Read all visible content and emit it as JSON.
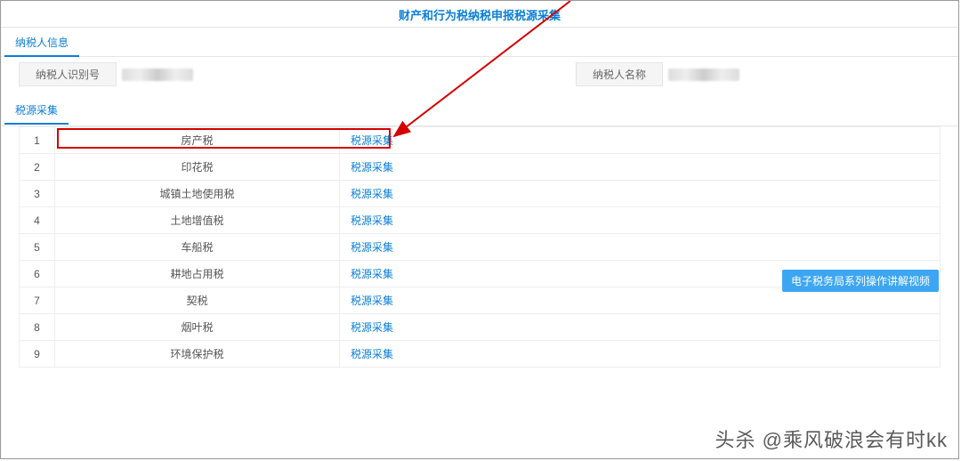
{
  "page_title": "财产和行为税纳税申报税源采集",
  "tabs": {
    "taxpayer_info": "纳税人信息",
    "source_collect": "税源采集"
  },
  "taxpayer": {
    "id_label": "纳税人识别号",
    "name_label": "纳税人名称"
  },
  "table": {
    "action_label": "税源采集",
    "rows": [
      {
        "idx": "1",
        "name": "房产税"
      },
      {
        "idx": "2",
        "name": "印花税"
      },
      {
        "idx": "3",
        "name": "城镇土地使用税",
        "highlight": true
      },
      {
        "idx": "4",
        "name": "土地增值税"
      },
      {
        "idx": "5",
        "name": "车船税"
      },
      {
        "idx": "6",
        "name": "耕地占用税"
      },
      {
        "idx": "7",
        "name": "契税"
      },
      {
        "idx": "8",
        "name": "烟叶税"
      },
      {
        "idx": "9",
        "name": "环境保护税"
      }
    ]
  },
  "help_button": "电子税务局系列操作讲解视频",
  "watermark": "头杀 @乘风破浪会有时kk"
}
